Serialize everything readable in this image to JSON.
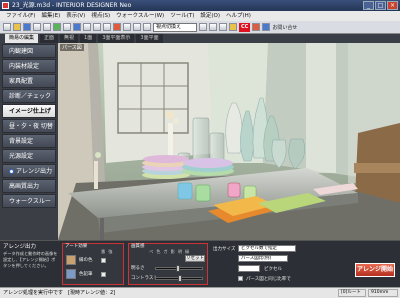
{
  "window": {
    "title": "23_光源.m3d - INTERIOR DESIGNER Neo",
    "minimize": "_",
    "maximize": "□",
    "close": "×"
  },
  "menu": [
    "ファイル(F)",
    "編集(E)",
    "表示(V)",
    "視点(S)",
    "ウォークスルー(W)",
    "ツール(T)",
    "設定(O)",
    "ヘルプ(H)"
  ],
  "toolbar": {
    "view_select": "視点切換え",
    "badge": "CC",
    "link_text": "お問い合せ"
  },
  "tabs": [
    "簡易の編集",
    "正面",
    "無視",
    "1面",
    "3面平面表示",
    "3面平面"
  ],
  "sidebar": {
    "items": [
      {
        "label": "内観建図"
      },
      {
        "label": "内装材設定"
      },
      {
        "label": "家具配置"
      },
      {
        "label": "診断／チェック"
      },
      {
        "label": "イメージ仕上げ"
      },
      {
        "label": "昼・夕・夜 切替"
      },
      {
        "label": "背景設定"
      },
      {
        "label": "光源設定"
      },
      {
        "label": "アレンジ出力"
      },
      {
        "label": "高画質出力"
      },
      {
        "label": "ウォークスルー"
      }
    ]
  },
  "viewport": {
    "label": "パース図"
  },
  "bottom": {
    "title": "アレンジ出力",
    "description": "データ作成と動作時の画像を設定し、【アレンジ開始】ボタンを押してください。",
    "group1": {
      "title": "アート効果",
      "headers": [
        "番",
        "強"
      ],
      "rows": [
        "縁の色",
        "色鉛筆"
      ]
    },
    "group2": {
      "title": "画質感",
      "headers": [
        "ペ",
        "色",
        "ガ",
        "影",
        "明",
        "縁"
      ],
      "rows": [
        "明るさ",
        "コントラスト"
      ],
      "reset_label": "リセット"
    },
    "output": {
      "size_label": "出力サイズ",
      "size_value": "ピクセル数で指定",
      "ratio_value": "パース図比(例)",
      "pixel_label": "ピクセル",
      "save_label": "パース図と同じ比率で",
      "start_button": "アレンジ開始"
    }
  },
  "status": {
    "text": "アレンジ処理を実行中です　[現時アレンジ値：2]",
    "route": "[0]ルート",
    "distance": "910mm"
  }
}
